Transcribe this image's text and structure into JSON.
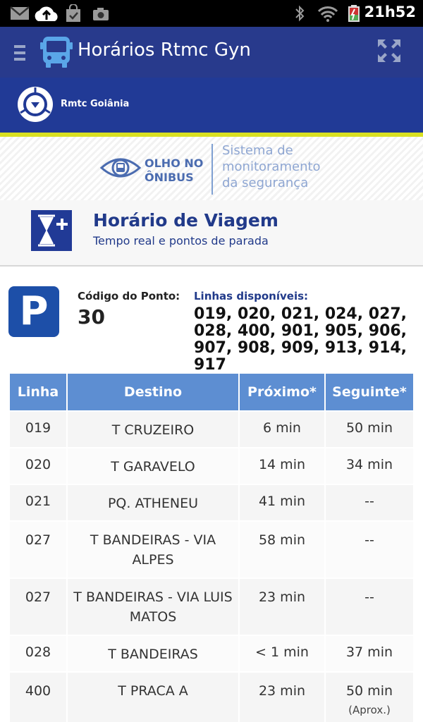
{
  "status_bar": {
    "time": "21h52",
    "icons": [
      "gmail-icon",
      "upload-icon",
      "market-icon",
      "camera-icon",
      "bluetooth-icon",
      "wifi-icon",
      "battery-icon"
    ]
  },
  "app_bar": {
    "title": "Horários Rtmc Gyn"
  },
  "brand": {
    "name": "Rmtc Goiânia"
  },
  "banner": {
    "olho_line1": "OLHO NO",
    "olho_line2": "ÔNIBUS",
    "subtitle_line1": "Sistema de",
    "subtitle_line2": "monitoramento",
    "subtitle_line3": "da segurança"
  },
  "section": {
    "title": "Horário de Viagem",
    "subtitle": "Tempo real e pontos de parada"
  },
  "stop": {
    "parking_letter": "P",
    "code_label": "Código do Ponto:",
    "code_value": "30",
    "lines_label": "Linhas disponíveis:",
    "lines_value": "019, 020, 021, 024, 027, 028, 400, 901, 905, 906, 907, 908, 909, 913, 914, 917"
  },
  "table": {
    "headers": [
      "Linha",
      "Destino",
      "Próximo*",
      "Seguinte*"
    ],
    "rows": [
      {
        "linha": "019",
        "destino": "T CRUZEIRO",
        "proximo": "6 min",
        "seguinte": "50 min",
        "nota": ""
      },
      {
        "linha": "020",
        "destino": "T GARAVELO",
        "proximo": "14 min",
        "seguinte": "34 min",
        "nota": ""
      },
      {
        "linha": "021",
        "destino": "PQ. ATHENEU",
        "proximo": "41 min",
        "seguinte": "--",
        "nota": ""
      },
      {
        "linha": "027",
        "destino": "T BANDEIRAS - VIA ALPES",
        "proximo": "58 min",
        "seguinte": "--",
        "nota": ""
      },
      {
        "linha": "027",
        "destino": "T BANDEIRAS - VIA LUIS MATOS",
        "proximo": "23 min",
        "seguinte": "--",
        "nota": ""
      },
      {
        "linha": "028",
        "destino": "T BANDEIRAS",
        "proximo": "< 1 min",
        "seguinte": "37 min",
        "nota": ""
      },
      {
        "linha": "400",
        "destino": "T PRACA A",
        "proximo": "23 min",
        "seguinte": "50 min",
        "nota": "(Aprox.)"
      }
    ]
  }
}
